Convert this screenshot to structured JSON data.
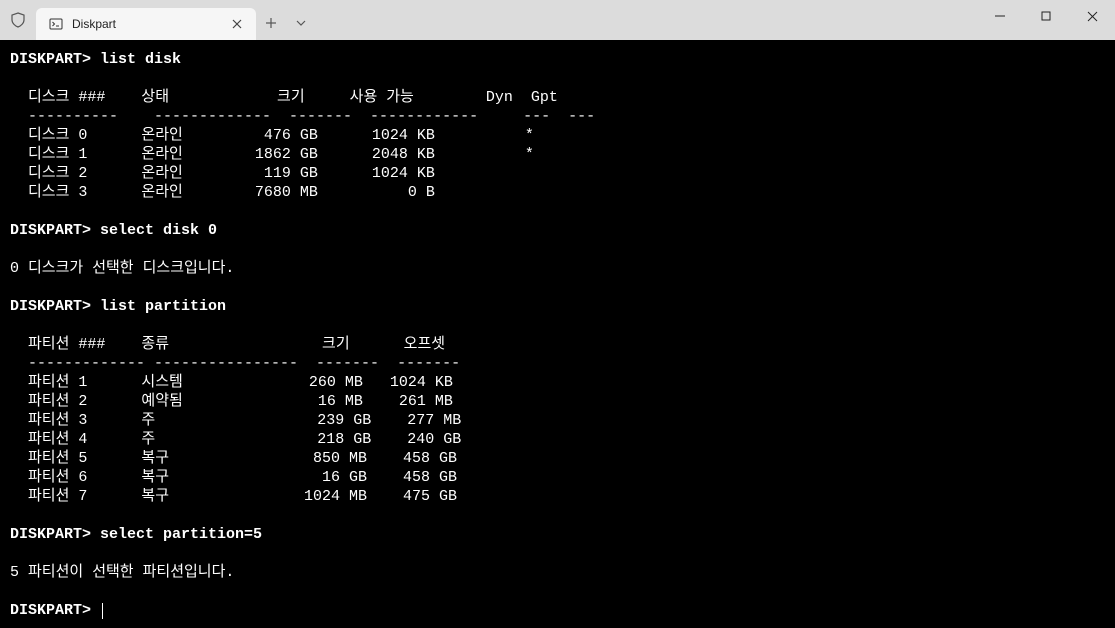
{
  "window": {
    "tab_title": "Diskpart"
  },
  "prompt": "DISKPART>",
  "cmd_list_disk": "list disk",
  "disk_header": {
    "c1": "디스크",
    "c2": "###",
    "c3": "상태",
    "c4": "크기",
    "c5": "사용 가능",
    "c6": "Dyn",
    "c7": "Gpt"
  },
  "disk_sep": {
    "c1": "----------",
    "c3": "-------------",
    "c4": "-------",
    "c5": "------------",
    "c6": "---",
    "c7": "---"
  },
  "disks": [
    {
      "label": "디스크 0",
      "status": "온라인",
      "size": "476 GB",
      "free": "1024 KB",
      "dyn": " ",
      "gpt": "*"
    },
    {
      "label": "디스크 1",
      "status": "온라인",
      "size": "1862 GB",
      "free": "2048 KB",
      "dyn": " ",
      "gpt": "*"
    },
    {
      "label": "디스크 2",
      "status": "온라인",
      "size": "119 GB",
      "free": "1024 KB",
      "dyn": " ",
      "gpt": " "
    },
    {
      "label": "디스크 3",
      "status": "온라인",
      "size": "7680 MB",
      "free": "0 B",
      "dyn": " ",
      "gpt": " "
    }
  ],
  "cmd_select_disk": "select disk 0",
  "msg_disk_selected": "0 디스크가 선택한 디스크입니다.",
  "cmd_list_partition": "list partition",
  "part_header": {
    "c1": "파티션",
    "c2": "###",
    "c3": "종류",
    "c4": "크기",
    "c5": "오프셋"
  },
  "part_sep": {
    "c1": "-------------",
    "c3": "----------------",
    "c4": "-------",
    "c5": "-------"
  },
  "partitions": [
    {
      "label": "파티션 1",
      "type": "시스템",
      "size": "260 MB",
      "offset": "1024 KB"
    },
    {
      "label": "파티션 2",
      "type": "예약됨",
      "size": "16 MB",
      "offset": "261 MB"
    },
    {
      "label": "파티션 3",
      "type": "주",
      "size": "239 GB",
      "offset": "277 MB"
    },
    {
      "label": "파티션 4",
      "type": "주",
      "size": "218 GB",
      "offset": "240 GB"
    },
    {
      "label": "파티션 5",
      "type": "복구",
      "size": "850 MB",
      "offset": "458 GB"
    },
    {
      "label": "파티션 6",
      "type": "복구",
      "size": "16 GB",
      "offset": "458 GB"
    },
    {
      "label": "파티션 7",
      "type": "복구",
      "size": "1024 MB",
      "offset": "475 GB"
    }
  ],
  "cmd_select_partition": "select partition=5",
  "msg_partition_selected": "5 파티션이 선택한 파티션입니다."
}
